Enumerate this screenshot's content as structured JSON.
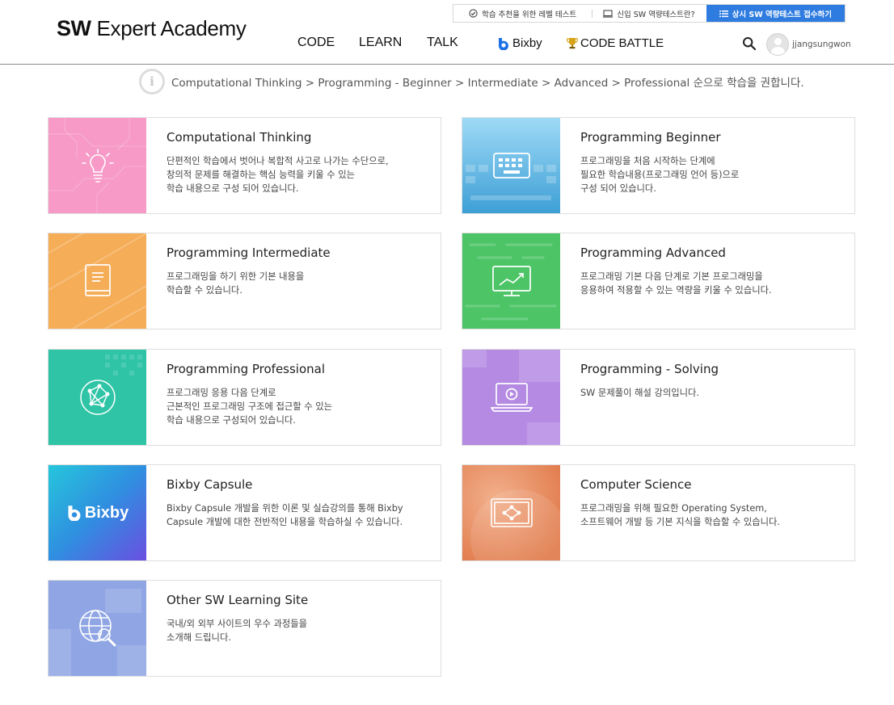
{
  "topbar": {
    "links": [
      {
        "label": "학습 추천을 위한 레벨 테스트",
        "icon": "check-circle-icon"
      },
      {
        "label": "신입 SW 역량테스트란?",
        "icon": "monitor-icon"
      },
      {
        "label": "상시 SW 역량테스트 접수하기",
        "icon": "list-icon"
      }
    ]
  },
  "logo": {
    "bold": "SW",
    "rest": "Expert Academy"
  },
  "nav": {
    "items": [
      "CODE",
      "LEARN",
      "TALK"
    ],
    "bixby": "Bixby",
    "code_battle": "CODE BATTLE"
  },
  "user": {
    "name": "jjangsungwon"
  },
  "breadcrumb": {
    "text": "Computational Thinking > Programming - Beginner > Intermediate > Advanced > Professional 순으로 학습을 권합니다."
  },
  "colors": {
    "accent_blue": "#2f7ce0"
  },
  "cards": [
    {
      "title": "Computational Thinking",
      "desc": "단편적인 학습에서 벗어나 복합적 사고로 나가는 수단으로,\n창의적 문제를 해결하는 핵심 능력을 키울 수 있는\n학습 내용으로 구성 되어 있습니다.",
      "icon": "lightbulb-icon",
      "color": "#f79ac7"
    },
    {
      "title": "Programming Beginner",
      "desc": "프로그래밍을 처음 시작하는 단계에\n필요한 학습내용(프로그래밍 언어 등)으로\n구성 되어 있습니다.",
      "icon": "keyboard-icon",
      "color": "#5bb8e8"
    },
    {
      "title": "Programming Intermediate",
      "desc": "프로그래밍을 하기 위한 기본 내용을\n학습할 수 있습니다.",
      "icon": "book-icon",
      "color": "#f5ad58"
    },
    {
      "title": "Programming Advanced",
      "desc": "프로그래밍 기본 다음 단계로 기본 프로그래밍을\n응용하여 적용할 수 있는 역량을 키울 수 있습니다.",
      "icon": "chart-monitor-icon",
      "color": "#4dc567"
    },
    {
      "title": "Programming Professional",
      "desc": "프로그래밍 응용 다음 단계로\n근본적인 프로그래밍 구조에 접근할 수 있는\n학습 내용으로 구성되어 있습니다.",
      "icon": "network-globe-icon",
      "color": "#2ec4a5"
    },
    {
      "title": "Programming - Solving",
      "desc": "SW 문제풀이 해설 강의입니다.",
      "icon": "video-laptop-icon",
      "color": "#b58ae3"
    },
    {
      "title": "Bixby Capsule",
      "desc": "Bixby Capsule 개발을 위한 이론 및 실습강의를 통해 Bixby\nCapsule 개발에 대한 전반적인 내용을 학습하실 수 있습니다.",
      "icon": "bixby-logo",
      "logo_text": "Bixby",
      "color": "#2aa8df"
    },
    {
      "title": "Computer Science",
      "desc": "프로그래밍을 위해 필요한 Operating System,\n소프트웨어 개발 등 기본 지식을 학습할 수 있습니다.",
      "icon": "diagram-board-icon",
      "color": "#ee9a72"
    },
    {
      "title": "Other SW Learning Site",
      "desc": "국내/외 외부 사이트의 우수 과정들을\n소개해 드립니다.",
      "icon": "globe-search-icon",
      "color": "#8fa5e4"
    }
  ]
}
